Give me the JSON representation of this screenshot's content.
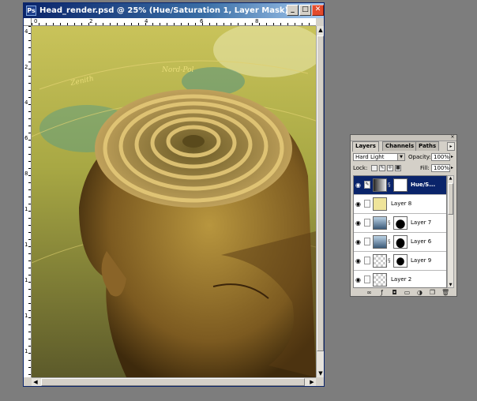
{
  "document": {
    "title": "Head_render.psd @ 25% (Hue/Saturation 1, Layer Mask)",
    "app_icon_letter": "Ps",
    "buttons": {
      "minimize": "_",
      "maximize": "□",
      "close": "✕"
    },
    "ruler_top": [
      "0",
      "2",
      "4",
      "6",
      "8"
    ],
    "ruler_left": [
      "4",
      "2",
      "4",
      "6",
      "8",
      "1",
      "1",
      "1",
      "1",
      "1"
    ],
    "canvas_text": [
      "Zenith",
      "Nord-Pol"
    ]
  },
  "layers_panel": {
    "tabs": [
      "Layers",
      "Channels",
      "Paths"
    ],
    "active_tab": "Layers",
    "blend_mode": "Hard Light",
    "opacity_label": "Opacity:",
    "opacity_value": "100%",
    "lock_label": "Lock:",
    "fill_label": "Fill:",
    "fill_value": "100%",
    "layers": [
      {
        "name": "Hue/S...",
        "visible": true,
        "selected": true,
        "thumb": "adjustment",
        "mask": "white"
      },
      {
        "name": "Layer 8",
        "visible": true,
        "selected": false,
        "thumb": "yellow",
        "mask": ""
      },
      {
        "name": "Layer 7",
        "visible": true,
        "selected": false,
        "thumb": "sky",
        "mask": "black-shape"
      },
      {
        "name": "Layer 6",
        "visible": true,
        "selected": false,
        "thumb": "sky",
        "mask": "black-shape"
      },
      {
        "name": "Layer 9",
        "visible": true,
        "selected": false,
        "thumb": "transparent",
        "mask": "black-blob"
      },
      {
        "name": "Layer 2",
        "visible": true,
        "selected": false,
        "thumb": "transparent-dark",
        "mask": ""
      }
    ],
    "bottom_tools": [
      "link-icon",
      "style-icon",
      "mask-icon",
      "set-icon",
      "adjust-icon",
      "new-layer-icon",
      "trash-icon"
    ]
  },
  "colors": {
    "desktop_bg": "#7d7d7d",
    "title_active": "#0a246a",
    "selected_layer": "#0a246a",
    "panel_bg": "#d4d0c8"
  }
}
